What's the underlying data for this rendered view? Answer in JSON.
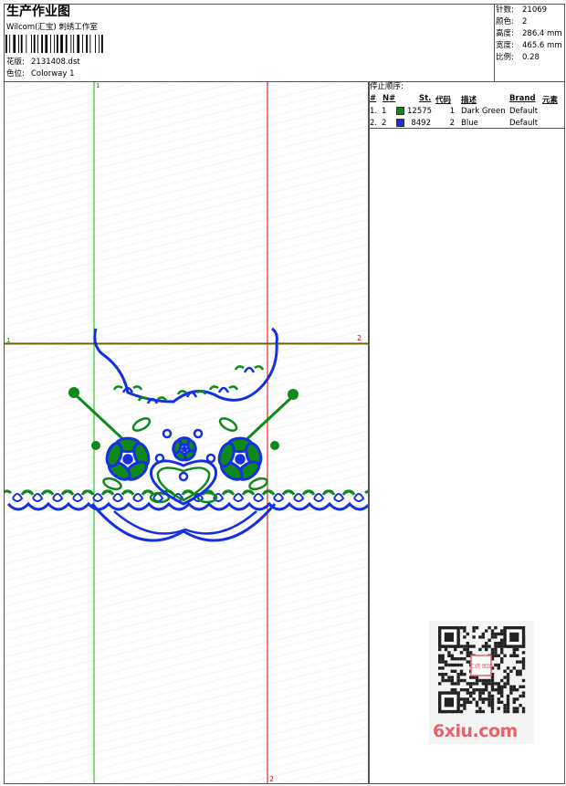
{
  "header": {
    "title": "生产作业图",
    "company": "Wilcom(汇宝) 刺绣工作室",
    "pattern_label": "花版:",
    "pattern_value": "2131408.dst",
    "colorway_label": "色位:",
    "colorway_value": "Colorway 1"
  },
  "stats": [
    {
      "label": "针数:",
      "value": "21069"
    },
    {
      "label": "颜色:",
      "value": "2"
    },
    {
      "label": "高度:",
      "value": "286.4 mm"
    },
    {
      "label": "宽度:",
      "value": "465.6 mm"
    },
    {
      "label": "比例:",
      "value": "0.28"
    }
  ],
  "stop_sequence": {
    "title": "停止顺序:",
    "columns": [
      "#",
      "N#",
      "St.",
      "代码",
      "描述",
      "Brand",
      "元素"
    ],
    "rows": [
      {
        "num": "1.",
        "n": "1",
        "color": "#0d8a1a",
        "st": "12575",
        "code": "1",
        "desc": "Dark Green",
        "brand": "Default"
      },
      {
        "num": "2.",
        "n": "2",
        "color": "#1530e0",
        "st": "8492",
        "code": "2",
        "desc": "Blue",
        "brand": "Default"
      }
    ]
  },
  "guides": {
    "v_green_label": "1",
    "h_green_label": "1",
    "h_red_label": "2",
    "v_red_label": "2"
  },
  "watermark": {
    "qr_text": "汇绣 图库",
    "logo": "6xiu.com"
  },
  "colors": {
    "green": "#0d8a1a",
    "blue": "#1530e0",
    "guide_green": "#00c000",
    "guide_red": "#e00000"
  }
}
